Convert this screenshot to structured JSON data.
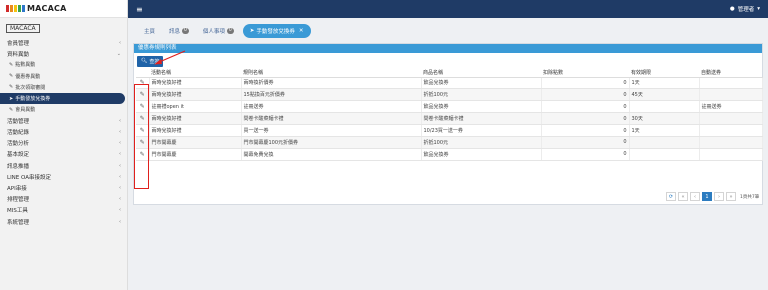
{
  "logo": {
    "text": "MACACA",
    "colors": [
      "#d12b2b",
      "#e98a1e",
      "#f2c40f",
      "#3aa34a",
      "#2d77c9"
    ]
  },
  "sidebar": {
    "label": "MACACA",
    "items": [
      {
        "label": "會員管理",
        "type": "group"
      },
      {
        "label": "資料異動",
        "type": "group",
        "open": true
      },
      {
        "label": "點數異動",
        "type": "sub",
        "icon": "edit-icon"
      },
      {
        "label": "優惠券異動",
        "type": "sub",
        "icon": "edit-icon"
      },
      {
        "label": "批次領取審閱",
        "type": "sub",
        "icon": "edit-icon"
      },
      {
        "label": "手動發放兌換券",
        "type": "sub",
        "icon": "send-icon",
        "active": true
      },
      {
        "label": "會員異動",
        "type": "sub",
        "icon": "pencil-icon"
      },
      {
        "label": "活動管理",
        "type": "group"
      },
      {
        "label": "活動紀錄",
        "type": "group"
      },
      {
        "label": "活動分析",
        "type": "group"
      },
      {
        "label": "基本設定",
        "type": "group"
      },
      {
        "label": "訊息推播",
        "type": "group"
      },
      {
        "label": "LINE OA串接設定",
        "type": "group"
      },
      {
        "label": "API串接",
        "type": "group"
      },
      {
        "label": "排程管理",
        "type": "group"
      },
      {
        "label": "MIS工具",
        "type": "group"
      },
      {
        "label": "系統管理",
        "type": "group"
      }
    ]
  },
  "topbar": {
    "user": "管理者"
  },
  "tabs": [
    {
      "label": "主頁",
      "badge": ""
    },
    {
      "label": "訊息",
      "badge": "0"
    },
    {
      "label": "個人事項",
      "badge": "0"
    },
    {
      "label": "手動發放兌換券",
      "badge": "",
      "active": true
    }
  ],
  "panel": {
    "title": "優惠券規則列表",
    "query_label": "查詢"
  },
  "table": {
    "headers": [
      "",
      "活動名稱",
      "規則名稱",
      "商品名稱",
      "扣除點數",
      "有效期限",
      "自動送券"
    ],
    "rows": [
      [
        "",
        "兩時兌換好禮",
        "兩時換折價券",
        "飲品兌換券",
        "0",
        "1天",
        ""
      ],
      [
        "",
        "兩時兌換好禮",
        "15點換百元折價券",
        "折抵100元",
        "0",
        "45天",
        ""
      ],
      [
        "",
        "註冊禮open it",
        "註冊送券",
        "飲品兌換券",
        "0",
        "",
        "註冊送券"
      ],
      [
        "",
        "兩時兌換好禮",
        "問卷卡酸菜麵卡禮",
        "問卷卡酸菜麵卡禮",
        "0",
        "30天",
        ""
      ],
      [
        "",
        "兩時兌換好禮",
        "買一送一券",
        "10/23買一送一券",
        "0",
        "1天",
        ""
      ],
      [
        "",
        "門市開幕慶",
        "門市開幕慶100元折價券",
        "折抵100元",
        "0",
        "",
        ""
      ],
      [
        "",
        "門市開幕慶",
        "開幕免費兌換",
        "飲品兌換券",
        "0",
        "",
        ""
      ]
    ]
  },
  "pager": {
    "refresh": "⟳",
    "first": "«",
    "prev": "‹",
    "current": "1",
    "next": "›",
    "last": "»",
    "info": "1頁共7筆"
  }
}
